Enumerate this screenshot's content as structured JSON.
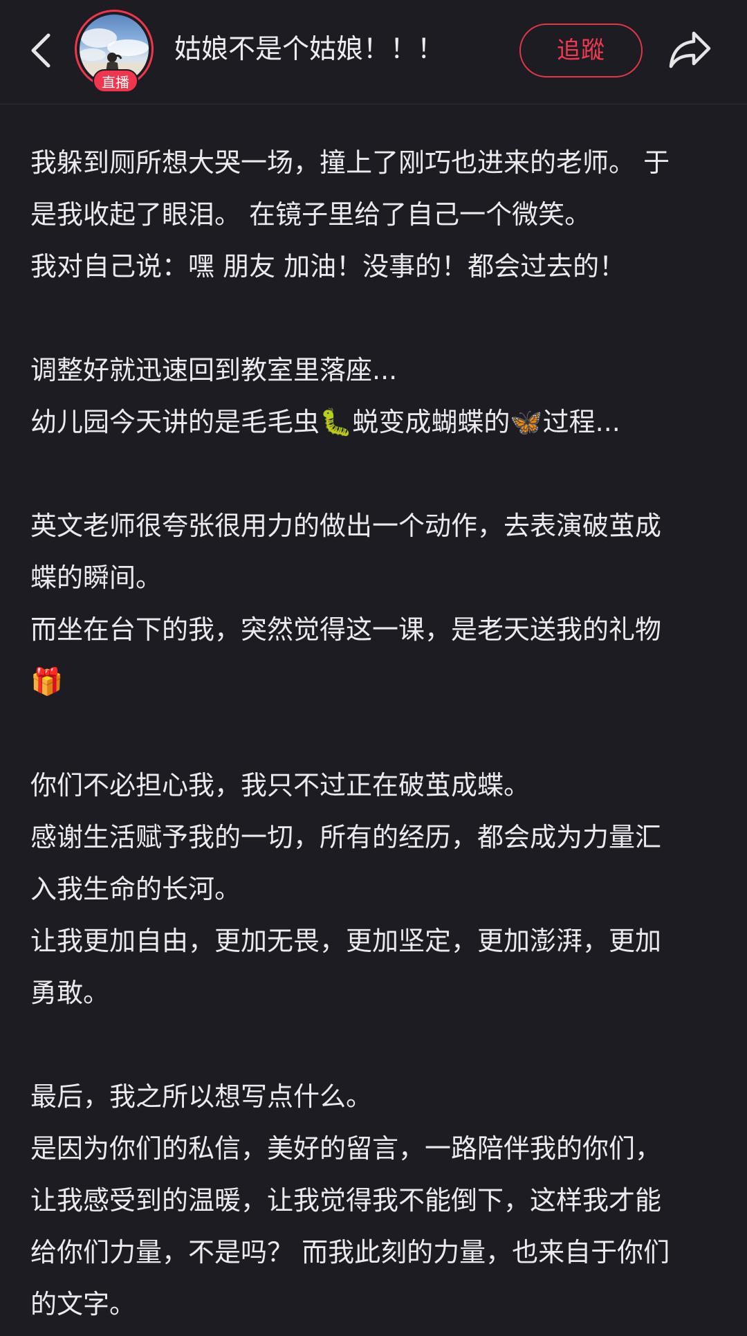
{
  "header": {
    "username": "姑娘不是个姑娘！！！",
    "live_badge": "直播",
    "follow_label": "追蹤",
    "back_icon": "chevron-left-icon",
    "share_icon": "share-arrow-icon"
  },
  "colors": {
    "background": "#1d1c22",
    "accent": "#ef3a52",
    "text": "#ebebee"
  },
  "post": {
    "paragraphs": [
      {
        "lines": [
          "我躲到厕所想大哭一场，撞上了刚巧也进来的老师。 于",
          "是我收起了眼泪。 在镜子里给了自己一个微笑。",
          "我对自己说：嘿 朋友 加油！没事的！都会过去的！"
        ]
      },
      {
        "lines": [
          "调整好就迅速回到教室里落座...",
          "幼儿园今天讲的是毛毛虫🐛蜕变成蝴蝶的🦋过程..."
        ]
      },
      {
        "lines": [
          "英文老师很夸张很用力的做出一个动作，去表演破茧成",
          "蝶的瞬间。",
          "而坐在台下的我，突然觉得这一课，是老天送我的礼物",
          "🎁"
        ]
      },
      {
        "lines": [
          "你们不必担心我，我只不过正在破茧成蝶。",
          "感谢生活赋予我的一切，所有的经历，都会成为力量汇",
          "入我生命的长河。",
          "让我更加自由，更加无畏，更加坚定，更加澎湃，更加",
          "勇敢。"
        ]
      },
      {
        "lines": [
          "最后，我之所以想写点什么。",
          "是因为你们的私信，美好的留言，一路陪伴我的你们，",
          "让我感受到的温暖，让我觉得我不能倒下，这样我才能",
          "给你们力量，不是吗？ 而我此刻的力量，也来自于你们",
          "的文字。"
        ]
      }
    ]
  }
}
